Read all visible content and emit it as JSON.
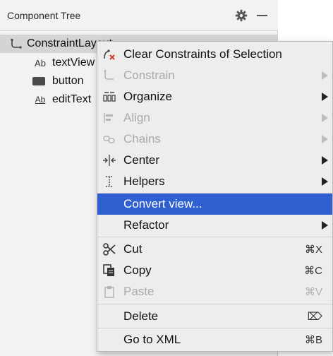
{
  "panel": {
    "title": "Component Tree",
    "actions": {
      "settings_icon": "gear-icon",
      "minimize_icon": "minimize-icon"
    }
  },
  "tree": {
    "items": [
      {
        "label": "ConstraintLayout",
        "icon": "constraint-layout-icon",
        "selected": true
      },
      {
        "label": "textView",
        "icon": "text-view-icon"
      },
      {
        "label": "button",
        "icon": "button-icon"
      },
      {
        "label": "editText",
        "icon": "edit-text-icon"
      }
    ]
  },
  "menu": {
    "items": [
      {
        "label": "Clear Constraints of Selection",
        "icon": "clear-constraints-icon"
      },
      {
        "label": "Constrain",
        "icon": "constrain-icon",
        "disabled": true,
        "submenu": true
      },
      {
        "label": "Organize",
        "icon": "organize-icon",
        "submenu": true
      },
      {
        "label": "Align",
        "icon": "align-icon",
        "disabled": true,
        "submenu": true
      },
      {
        "label": "Chains",
        "icon": "chains-icon",
        "disabled": true,
        "submenu": true
      },
      {
        "label": "Center",
        "icon": "center-icon",
        "submenu": true
      },
      {
        "label": "Helpers",
        "icon": "helpers-icon",
        "submenu": true
      },
      {
        "label": "Convert view...",
        "highlighted": true
      },
      {
        "label": "Refactor",
        "submenu": true
      },
      {
        "label": "Cut",
        "icon": "scissors-icon",
        "shortcut": "⌘X"
      },
      {
        "label": "Copy",
        "icon": "copy-icon",
        "shortcut": "⌘C"
      },
      {
        "label": "Paste",
        "icon": "paste-icon",
        "shortcut": "⌘V",
        "disabled": true
      },
      {
        "label": "Delete",
        "shortcut": "⌦"
      },
      {
        "label": "Go to XML",
        "shortcut": "⌘B"
      }
    ]
  },
  "colors": {
    "highlight": "#2f5fd0",
    "panel_bg": "#f2f2f2",
    "menu_bg": "#ededed",
    "disabled_text": "#a9a9a9"
  }
}
